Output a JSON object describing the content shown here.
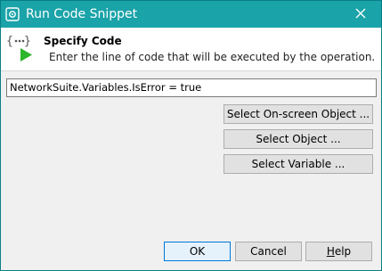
{
  "window": {
    "title": "Run Code Snippet"
  },
  "header": {
    "title": "Specify Code",
    "description": "Enter the line of code that will be executed by the operation.",
    "icon": "code-snippet-icon"
  },
  "code_field": {
    "value": "NetworkSuite.Variables.IsError = true"
  },
  "side_buttons": {
    "onscreen": "Select On-screen Object ...",
    "object": "Select Object ...",
    "variable": "Select Variable ..."
  },
  "footer": {
    "ok": "OK",
    "cancel": "Cancel",
    "help_mnemonic": "H",
    "help_rest": "elp"
  },
  "colors": {
    "titlebar": "#1aa3a8",
    "accent": "#0078d7",
    "play_green": "#2db52d"
  }
}
